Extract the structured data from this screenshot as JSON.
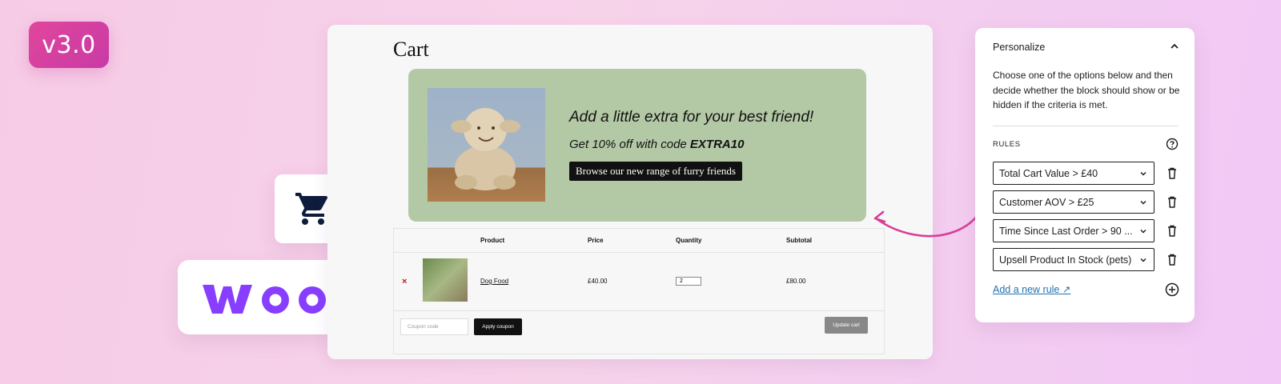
{
  "version_badge": "v3.0",
  "brand": {
    "logo_text": "WOO",
    "accent": "#873eff"
  },
  "store": {
    "title": "Cart",
    "promo": {
      "headline": "Add a little extra for your best friend!",
      "code_prefix": "Get 10% off with code ",
      "code": "EXTRA10",
      "button": "Browse our new range of furry friends",
      "background": "#b3c8a5"
    },
    "table": {
      "headers": [
        "Product",
        "Price",
        "Quantity",
        "Subtotal"
      ],
      "rows": [
        {
          "product": "Dog Food",
          "price": "£40.00",
          "quantity": "2",
          "subtotal": "£80.00"
        }
      ],
      "remove_symbol": "×",
      "coupon_placeholder": "Coupon code",
      "apply_coupon": "Apply coupon",
      "update_cart": "Update cart"
    }
  },
  "panel": {
    "title": "Personalize",
    "description": "Choose one of the options below and then decide whether the block should show or be hidden if the criteria is met.",
    "rules_label": "RULES",
    "rules": [
      "Total Cart Value > £40",
      "Customer AOV > £25",
      "Time Since Last Order > 90 ...",
      "Upsell Product In Stock (pets)"
    ],
    "add_rule": "Add a new rule ↗"
  },
  "colors": {
    "badge": "#d63fa0",
    "link": "#2271b1",
    "arrow": "#d93d96",
    "cart_icon": "#0e1b3d"
  }
}
